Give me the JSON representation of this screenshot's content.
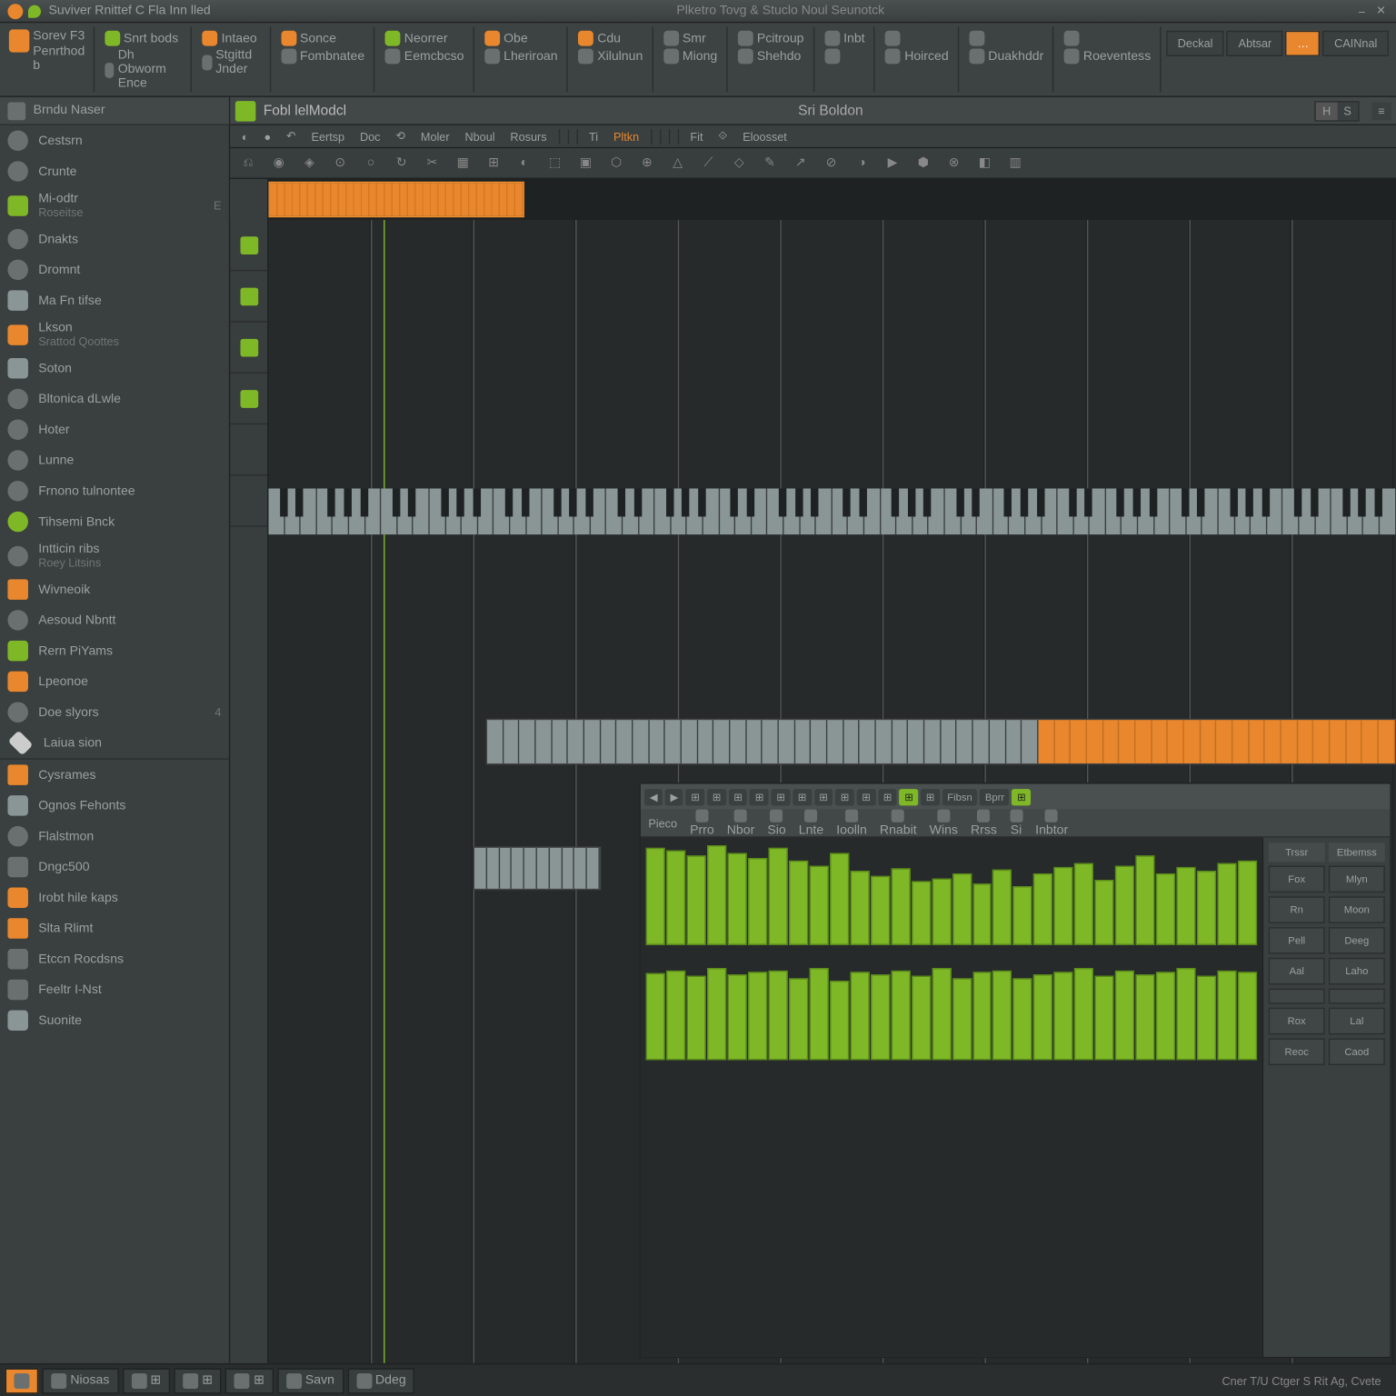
{
  "titlebar": {
    "main": "Suviver Rnittef C Fla Inn lled",
    "center": "Plketro Tovg & Stuclo Noul Seunotck"
  },
  "ribbon": {
    "groups": [
      {
        "big": {
          "line1": "Sorev F3",
          "line2": "Penrthod b"
        }
      },
      {
        "items": [
          "Snrt bods",
          "Dh Obworm Ence"
        ]
      },
      {
        "items": [
          "Intaeo",
          "Stgittd Jnder"
        ]
      },
      {
        "items": [
          "Sonce",
          "Fombnatee"
        ]
      },
      {
        "items": [
          "Neorrer",
          "Eemcbcso"
        ]
      },
      {
        "items": [
          "Obe",
          "Lheriroan"
        ]
      },
      {
        "items": [
          "Cdu",
          "Xilulnun"
        ]
      },
      {
        "items": [
          "Smr",
          "Miong"
        ]
      },
      {
        "items": [
          "Pcitroup",
          "Shehdo"
        ]
      },
      {
        "items": [
          "Inbt",
          ""
        ]
      },
      {
        "items": [
          "",
          "Hoirced"
        ]
      },
      {
        "items": [
          "",
          "Duakhddr"
        ]
      },
      {
        "items": [
          "",
          "Roeventess"
        ]
      }
    ],
    "end": [
      "Deckal",
      "Abtsar",
      "…",
      "CAINnal"
    ]
  },
  "sidebar": {
    "header": "Brndu Naser",
    "groups": [
      [
        {
          "color": "#6a7070",
          "shape": "round",
          "label": "Cestsrn"
        },
        {
          "color": "#6a7070",
          "shape": "round",
          "label": "Crunte"
        },
        {
          "color": "#7fb827",
          "shape": "sq",
          "label": "Mi-odtr",
          "sub": "Roseitse",
          "badge": "E"
        },
        {
          "color": "#6a7070",
          "shape": "round",
          "label": "Dnakts"
        },
        {
          "color": "#6a7070",
          "shape": "round",
          "label": "Dromnt"
        },
        {
          "color": "#8a9595",
          "shape": "sq",
          "label": "Ma Fn tifse"
        },
        {
          "color": "#e8872d",
          "shape": "fruit",
          "label": "Lkson",
          "sub": "Srattod Qoottes"
        },
        {
          "color": "#8a9595",
          "shape": "arrow",
          "label": "Soton"
        },
        {
          "color": "#6a7070",
          "shape": "round",
          "label": "Bltonica dLwle"
        },
        {
          "color": "#6a7070",
          "shape": "round",
          "label": "Hoter"
        },
        {
          "color": "#6a7070",
          "shape": "round",
          "label": "Lunne"
        },
        {
          "color": "#6a7070",
          "shape": "round",
          "label": "Frnono tulnontee"
        },
        {
          "color": "#7fb827",
          "shape": "round",
          "label": "Tihsemi Bnck"
        },
        {
          "color": "#6a7070",
          "shape": "round",
          "label": "Intticin ribs",
          "sub": "Roey Litsins"
        },
        {
          "color": "#e8872d",
          "shape": "folder",
          "label": "Wivneoik"
        },
        {
          "color": "#6a7070",
          "shape": "round",
          "label": "Aesoud Nbntt"
        },
        {
          "color": "#7fb827",
          "shape": "sq",
          "label": "Rern PiYams"
        },
        {
          "color": "#e8872d",
          "shape": "sq",
          "label": "Lpeonoe"
        },
        {
          "color": "#6a7070",
          "shape": "round",
          "label": "Doe slyors",
          "badge": "4"
        },
        {
          "color": "#cccccc",
          "shape": "diamond",
          "label": "Laiua sion"
        }
      ],
      [
        {
          "color": "#e8872d",
          "shape": "folder",
          "label": "Cysrames"
        },
        {
          "color": "#8a9595",
          "shape": "sq",
          "label": "Ognos Fehonts"
        },
        {
          "color": "#6a7070",
          "shape": "round",
          "label": "Flalstmon"
        },
        {
          "color": "#6a7070",
          "shape": "sq",
          "label": "Dngc500"
        },
        {
          "color": "#e8872d",
          "shape": "flag",
          "label": "Irobt hile kaps"
        },
        {
          "color": "#e8872d",
          "shape": "folder",
          "label": "Slta Rlimt"
        },
        {
          "color": "#6a7070",
          "shape": "sq",
          "label": "Etccn Rocdsns"
        },
        {
          "color": "#6a7070",
          "shape": "sq",
          "label": "Feeltr I-Nst"
        },
        {
          "color": "#8a9595",
          "shape": "leaf",
          "label": "Suonite"
        }
      ]
    ]
  },
  "main": {
    "header": {
      "title": "Fobl lelModcl",
      "center": "Sri Boldon",
      "toggle": [
        "H",
        "S"
      ],
      "menu": "≡"
    },
    "toolstrip": [
      "◐",
      "●",
      "↶",
      "Eertsp",
      "Doc",
      "⟲",
      "Moler",
      "Nboul",
      "Rosurs",
      "",
      "",
      "",
      "Ti",
      "Pltkn",
      "",
      "",
      "",
      "",
      "Fit",
      "⟐",
      "Eloosset"
    ],
    "toolstrip_hl_index": 13,
    "iconstrip_count": 26
  },
  "panel": {
    "tb": [
      "◀",
      "▶",
      "⊞",
      "⊞",
      "⊞",
      "⊞",
      "⊞",
      "⊞",
      "⊞",
      "⊞",
      "⊞",
      "⊞",
      "⊞",
      "⊞",
      "Fibsn",
      "Bprr",
      "⊞"
    ],
    "tb_green": [
      12,
      16
    ],
    "tb2_first": "Pieco",
    "tb2": [
      {
        "l": "Prro"
      },
      {
        "l": "Nbor"
      },
      {
        "l": "Sio"
      },
      {
        "l": "Lnte"
      },
      {
        "l": "Ioolln"
      },
      {
        "l": "Rnabit"
      },
      {
        "l": "Wins"
      },
      {
        "l": "Rrss"
      },
      {
        "l": "Si"
      },
      {
        "l": "Inbtor"
      }
    ],
    "side": {
      "head": [
        "Trssr",
        "Etbemss"
      ],
      "grid": [
        "Fox",
        "Mlyn",
        "Rn",
        "Moon",
        "Pell",
        "Deeg",
        "Aal",
        "Laho",
        "",
        "",
        "Rox",
        "Lal",
        "Reoc",
        "Caod"
      ]
    }
  },
  "chart_data": {
    "type": "bar",
    "series": [
      {
        "name": "row1",
        "values": [
          95,
          92,
          88,
          98,
          90,
          85,
          95,
          82,
          78,
          90,
          72,
          68,
          75,
          62,
          65,
          70,
          60,
          74,
          58,
          70,
          76,
          80,
          64,
          78,
          88,
          70,
          76,
          72,
          80,
          82
        ]
      },
      {
        "name": "row2",
        "values": [
          85,
          88,
          82,
          90,
          84,
          86,
          88,
          80,
          90,
          78,
          86,
          84,
          88,
          82,
          90,
          80,
          86,
          88,
          80,
          84,
          86,
          90,
          82,
          88,
          84,
          86,
          90,
          82,
          88,
          86
        ]
      }
    ],
    "ylim": [
      0,
      100
    ]
  },
  "statusbar": {
    "buttons": [
      "",
      "Niosas",
      "⊞",
      "⊞",
      "⊞",
      "Savn",
      "Ddeg"
    ],
    "text": "Cner T/U Ctger S Rit Ag, Cvete"
  }
}
